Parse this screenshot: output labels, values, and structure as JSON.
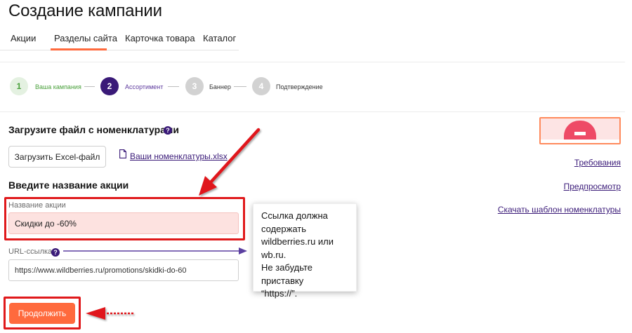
{
  "page": {
    "title": "Создание кампании"
  },
  "tabs": [
    {
      "label": "Акции"
    },
    {
      "label": "Разделы сайта"
    },
    {
      "label": "Карточка товара"
    },
    {
      "label": "Каталог"
    }
  ],
  "active_tab_index": 1,
  "stepper": {
    "current_step": 2,
    "steps": [
      {
        "number": "1",
        "label": "Ваша кампания",
        "status": "done"
      },
      {
        "number": "2",
        "label": "Ассортимент",
        "status": "active"
      },
      {
        "number": "3",
        "label": "Баннер",
        "status": "pending"
      },
      {
        "number": "4",
        "label": "Подтверждение",
        "status": "pending"
      }
    ]
  },
  "upload": {
    "title": "Загрузите файл с номенклатурами",
    "help": "?",
    "button_label": "Загрузить Excel-файл",
    "file_link": "Ваши номенклатуры.xlsx",
    "file_icon": "file-icon"
  },
  "promo": {
    "title": "Введите название акции",
    "name_label": "Название акции",
    "name_value": "Скидки до -60%",
    "url_label": "URL-ссылка",
    "url_help": "?",
    "url_value": "https://www.wildberries.ru/promotions/skidki-do-60"
  },
  "tooltip": {
    "lines": [
      "Ссылка должна",
      "содержать",
      "wildberries.ru или",
      "wb.ru.",
      "Не забудьте приставку",
      "“https://”."
    ]
  },
  "actions": {
    "continue_label": "Продолжить"
  },
  "right_panel": {
    "requirements_link": "Требования",
    "preview_link": "Предпросмотр",
    "template_link": "Скачать шаблон номенклатуры",
    "banner_icon": "banner-preview-image"
  },
  "colors": {
    "accent": "#ff6a3d",
    "brand_purple": "#3a1a78",
    "step_done_green": "#49a03b",
    "highlight_red": "#e0191b",
    "annotation_arrow_purple": "#5b3fa0",
    "name_field_fill": "#fde2e0"
  }
}
